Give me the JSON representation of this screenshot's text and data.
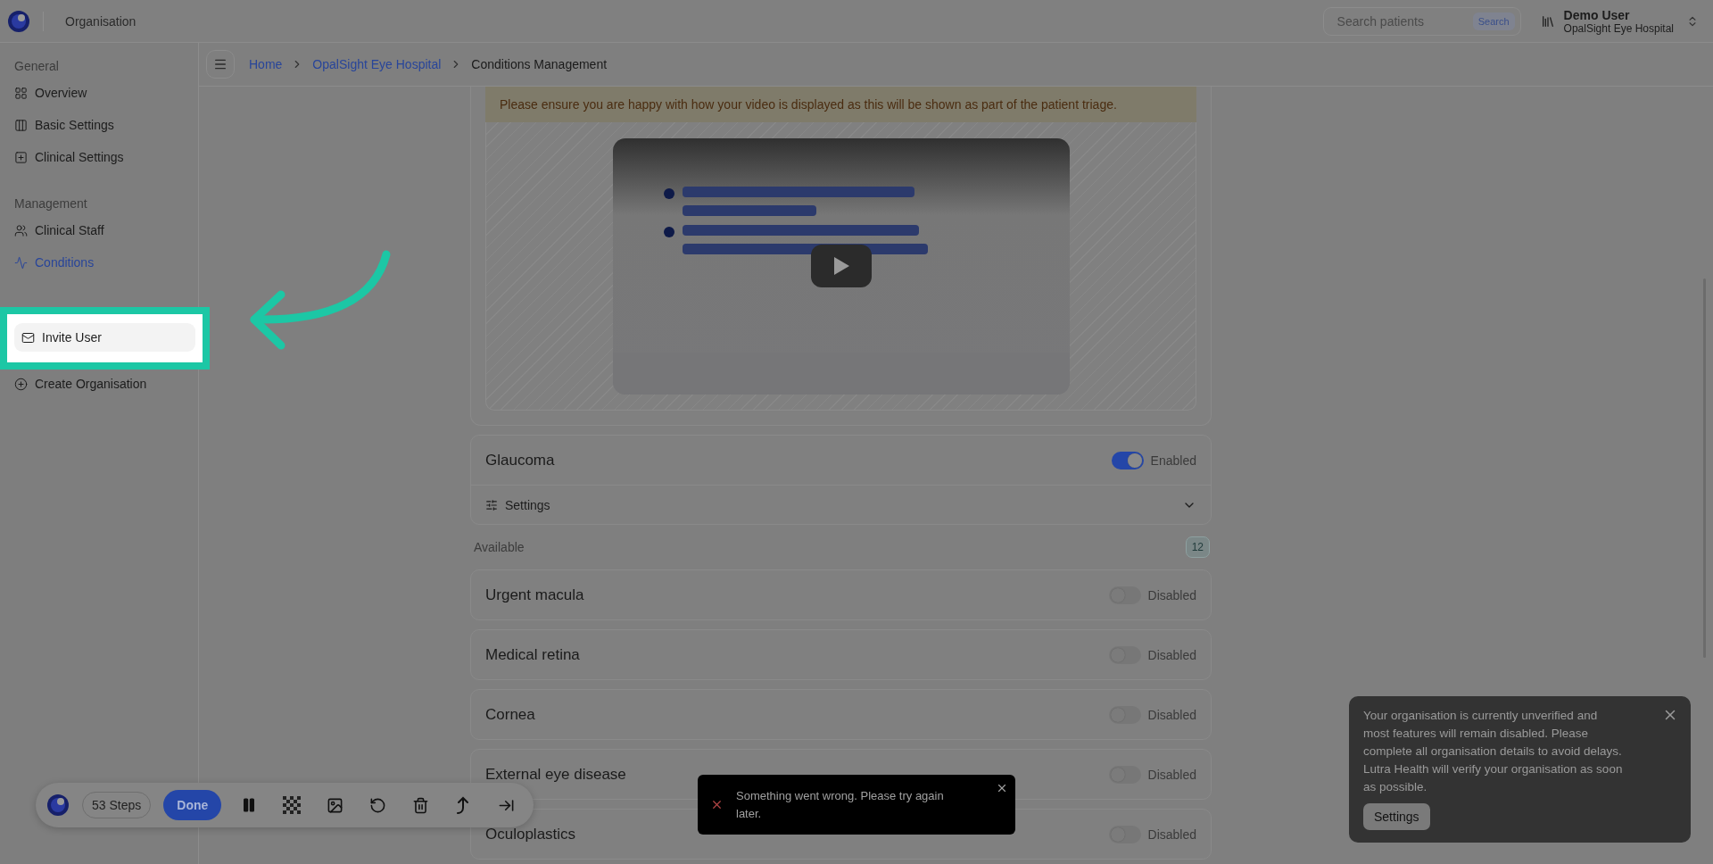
{
  "app_bar": {
    "title": "Organisation",
    "search": {
      "placeholder": "Search patients",
      "button": "Search"
    },
    "user": {
      "name": "Demo User",
      "organisation": "OpalSight Eye Hospital"
    }
  },
  "sidebar": {
    "groups": [
      {
        "heading": "General",
        "items": [
          {
            "label": "Overview",
            "selected": false,
            "highlighted": false
          },
          {
            "label": "Basic Settings",
            "selected": false,
            "highlighted": false
          },
          {
            "label": "Clinical Settings",
            "selected": false,
            "highlighted": false
          }
        ]
      },
      {
        "heading": "Management",
        "items": [
          {
            "label": "Clinical Staff",
            "selected": false,
            "highlighted": false
          },
          {
            "label": "Conditions",
            "selected": true,
            "highlighted": false
          }
        ]
      },
      {
        "items": [
          {
            "label": "Invite User",
            "selected": false,
            "highlighted": true
          },
          {
            "label": "Create Organisation",
            "selected": false,
            "highlighted": false
          }
        ]
      }
    ]
  },
  "breadcrumb": [
    {
      "label": "Home",
      "current": false
    },
    {
      "label": "OpalSight Eye Hospital",
      "current": false
    },
    {
      "label": "Conditions Management",
      "current": true
    }
  ],
  "video_section": {
    "notice": "Please ensure you are happy with how your video is displayed as this will be shown as part of the patient triage."
  },
  "active_condition": {
    "name": "Glaucoma",
    "on": true,
    "status": "Enabled",
    "settings": {
      "label": "Settings",
      "expanded": false
    }
  },
  "available": {
    "heading": "Available",
    "count": "12",
    "conditions": [
      {
        "name": "Urgent macula",
        "on": false,
        "status": "Disabled"
      },
      {
        "name": "Medical retina",
        "on": false,
        "status": "Disabled"
      },
      {
        "name": "Cornea",
        "on": false,
        "status": "Disabled"
      },
      {
        "name": "External eye disease",
        "on": false,
        "status": "Disabled"
      },
      {
        "name": "Oculoplastics",
        "on": false,
        "status": "Disabled"
      }
    ]
  },
  "recorder_toolbar": {
    "steps": "53 Steps",
    "done": "Done"
  },
  "error_toast": {
    "message": "Something went wrong. Please try again later."
  },
  "notice_popup": {
    "message": "Your organisation is currently unverified and most features will remain disabled. Please complete all organisation details to avoid delays. Lutra Health will verify your organisation as soon as possible.",
    "button": "Settings"
  }
}
